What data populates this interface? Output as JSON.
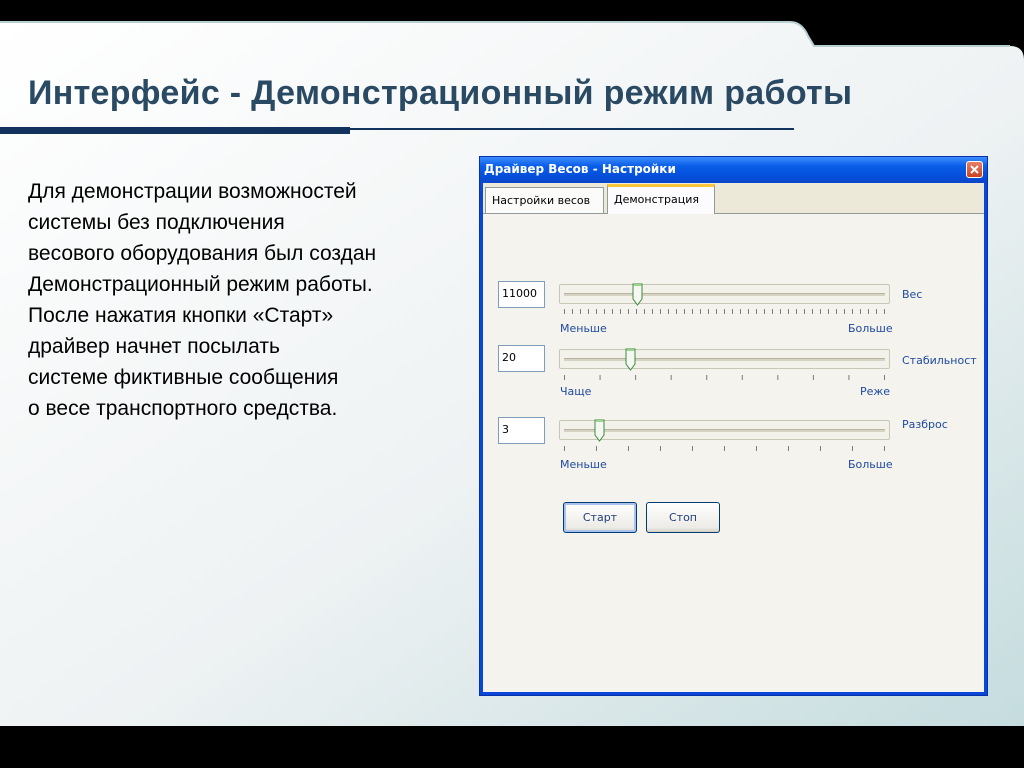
{
  "slide": {
    "title": "Интерфейс - Демонстрационный режим работы",
    "body_lines": [
      "Для демонстрации возможностей",
      "системы без подключения",
      "весового оборудования был создан",
      "Демонстрационный режим работы.",
      "После нажатия кнопки «Старт»",
      "драйвер начнет посылать",
      "системе фиктивные сообщения",
      "о весе транспортного средства."
    ]
  },
  "dialog": {
    "title": "Драйвер Весов - Настройки",
    "tabs": [
      {
        "label": "Настройки весов",
        "active": false
      },
      {
        "label": "Демонстрация",
        "active": true
      }
    ],
    "sliders": [
      {
        "value": "11000",
        "label": "Вес",
        "min_label": "Меньше",
        "max_label": "Больше",
        "level": 0.22
      },
      {
        "value": "20",
        "label": "Стабильност",
        "min_label": "Чаще",
        "max_label": "Реже",
        "level": 0.2
      },
      {
        "value": "3",
        "label": "Разброс",
        "min_label": "Меньше",
        "max_label": "Больше",
        "level": 0.1
      }
    ],
    "buttons": {
      "start": "Старт",
      "stop": "Стоп"
    }
  },
  "colors": {
    "title": "#2a4a63",
    "accent_rule": "#13335f",
    "xp_titlebar": "#0a5ee8",
    "label_blue": "#1f4aa0"
  }
}
